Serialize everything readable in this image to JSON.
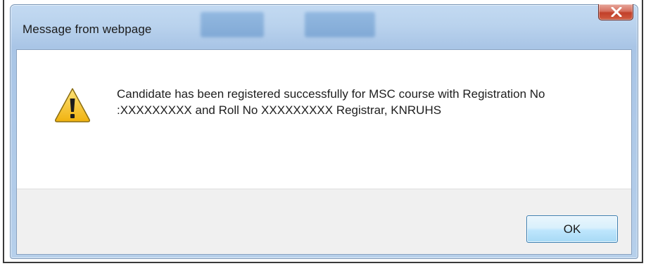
{
  "dialog": {
    "title": "Message from webpage",
    "close_icon": "close-icon",
    "message": "Candidate has been registered successfully for MSC course with Registration No :XXXXXXXXX and Roll No XXXXXXXXX Registrar, KNRUHS",
    "icon": "warning-icon",
    "ok_label": "OK"
  },
  "colors": {
    "titlebar": "#b9d2ed",
    "close_button": "#c7452f",
    "button_area": "#f0f0f0",
    "warning_yellow": "#f5c623"
  }
}
